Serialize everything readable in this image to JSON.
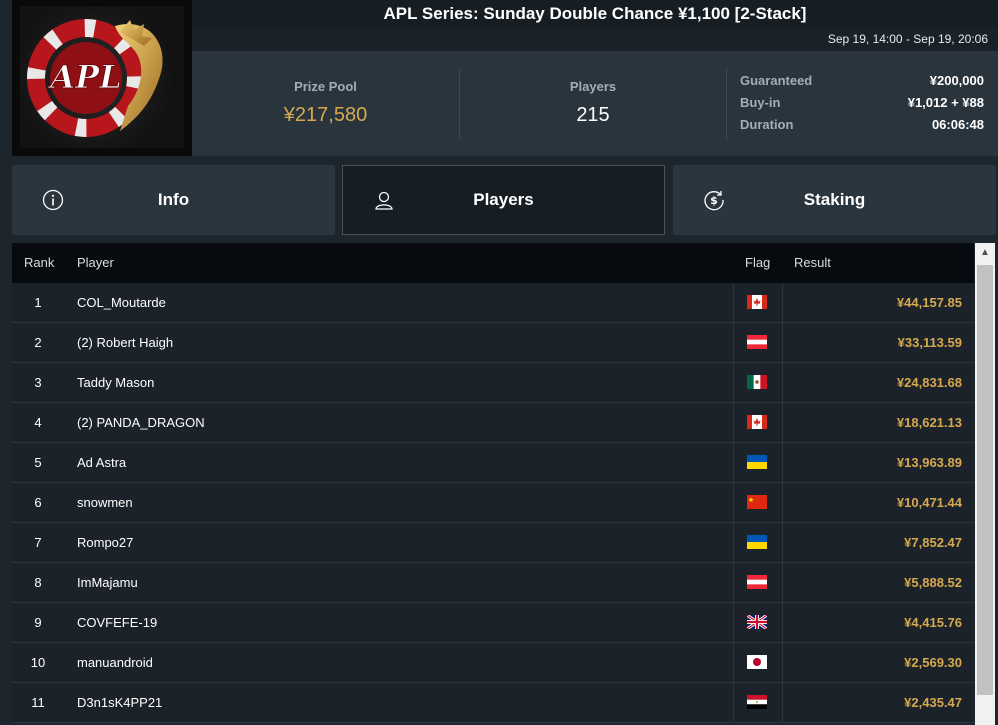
{
  "header": {
    "title": "APL Series: Sunday Double Chance ¥1,100 [2-Stack]",
    "dates": "Sep 19, 14:00 - Sep 19, 20:06",
    "logo_text": "APL"
  },
  "stats": {
    "prize_pool_label": "Prize Pool",
    "prize_pool_value": "¥217,580",
    "players_label": "Players",
    "players_value": "215",
    "details": [
      {
        "label": "Guaranteed",
        "value": "¥200,000"
      },
      {
        "label": "Buy-in",
        "value": "¥1,012 + ¥88"
      },
      {
        "label": "Duration",
        "value": "06:06:48"
      }
    ]
  },
  "tabs": [
    {
      "label": "Info",
      "icon": "info-icon"
    },
    {
      "label": "Players",
      "icon": "user-icon",
      "active": true
    },
    {
      "label": "Staking",
      "icon": "dollar-coin-icon"
    }
  ],
  "table": {
    "columns": {
      "rank": "Rank",
      "player": "Player",
      "flag": "Flag",
      "result": "Result"
    },
    "rows": [
      {
        "rank": "1",
        "player": "COL_Moutarde",
        "flag": "canada-flag",
        "result": "¥44,157.85"
      },
      {
        "rank": "2",
        "player": "(2) Robert Haigh",
        "flag": "austria-flag",
        "result": "¥33,113.59"
      },
      {
        "rank": "3",
        "player": "Taddy Mason",
        "flag": "mexico-flag",
        "result": "¥24,831.68"
      },
      {
        "rank": "4",
        "player": "(2) PANDA_DRAGON",
        "flag": "canada-flag",
        "result": "¥18,621.13"
      },
      {
        "rank": "5",
        "player": "Ad Astra",
        "flag": "ukraine-flag",
        "result": "¥13,963.89"
      },
      {
        "rank": "6",
        "player": "snowmen",
        "flag": "china-flag",
        "result": "¥10,471.44"
      },
      {
        "rank": "7",
        "player": "Rompo27",
        "flag": "ukraine-flag",
        "result": "¥7,852.47"
      },
      {
        "rank": "8",
        "player": "ImMajamu",
        "flag": "austria-flag",
        "result": "¥5,888.52"
      },
      {
        "rank": "9",
        "player": "COVFEFE-19",
        "flag": "uk-flag",
        "result": "¥4,415.76"
      },
      {
        "rank": "10",
        "player": "manuandroid",
        "flag": "japan-flag",
        "result": "¥2,569.30"
      },
      {
        "rank": "11",
        "player": "D3n1sK4PP21",
        "flag": "egypt-flag",
        "result": "¥2,435.47"
      }
    ]
  },
  "colors": {
    "accent_gold": "#d7a94e",
    "background": "#1d252d",
    "header_dark": "#070b0f"
  }
}
